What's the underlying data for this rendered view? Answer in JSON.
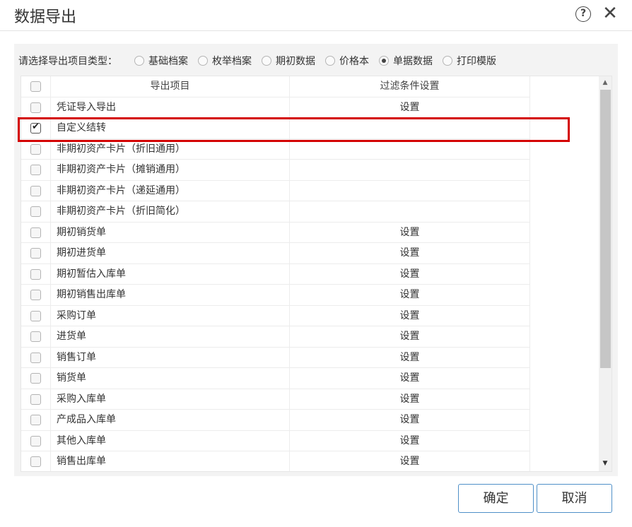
{
  "dialog": {
    "title": "数据导出",
    "help_glyph": "?",
    "close_glyph": "✕"
  },
  "type_selector": {
    "label": "请选择导出项目类型：",
    "options": [
      {
        "label": "基础档案",
        "selected": false
      },
      {
        "label": "枚举档案",
        "selected": false
      },
      {
        "label": "期初数据",
        "selected": false
      },
      {
        "label": "价格本",
        "selected": false
      },
      {
        "label": "单据数据",
        "selected": true
      },
      {
        "label": "打印模版",
        "selected": false
      }
    ]
  },
  "table": {
    "headers": {
      "item": "导出项目",
      "filter": "过滤条件设置"
    },
    "rows": [
      {
        "name": "凭证导入导出",
        "filter": "设置",
        "checked": false
      },
      {
        "name": "自定义结转",
        "filter": "",
        "checked": true
      },
      {
        "name": "非期初资产卡片（折旧通用）",
        "filter": "",
        "checked": false
      },
      {
        "name": "非期初资产卡片（摊销通用）",
        "filter": "",
        "checked": false
      },
      {
        "name": "非期初资产卡片（递延通用）",
        "filter": "",
        "checked": false
      },
      {
        "name": "非期初资产卡片（折旧简化）",
        "filter": "",
        "checked": false
      },
      {
        "name": "期初销货单",
        "filter": "设置",
        "checked": false
      },
      {
        "name": "期初进货单",
        "filter": "设置",
        "checked": false
      },
      {
        "name": "期初暂估入库单",
        "filter": "设置",
        "checked": false
      },
      {
        "name": "期初销售出库单",
        "filter": "设置",
        "checked": false
      },
      {
        "name": "采购订单",
        "filter": "设置",
        "checked": false
      },
      {
        "name": "进货单",
        "filter": "设置",
        "checked": false
      },
      {
        "name": "销售订单",
        "filter": "设置",
        "checked": false
      },
      {
        "name": "销货单",
        "filter": "设置",
        "checked": false
      },
      {
        "name": "采购入库单",
        "filter": "设置",
        "checked": false
      },
      {
        "name": "产成品入库单",
        "filter": "设置",
        "checked": false
      },
      {
        "name": "其他入库单",
        "filter": "设置",
        "checked": false
      },
      {
        "name": "销售出库单",
        "filter": "设置",
        "checked": false
      }
    ]
  },
  "scrollbar": {
    "up_glyph": "▲",
    "down_glyph": "▼"
  },
  "buttons": {
    "ok": "确定",
    "cancel": "取消"
  },
  "colors": {
    "highlight": "#d40000",
    "button_border": "#4f90c8",
    "panel_bg": "#f3f3f3"
  }
}
